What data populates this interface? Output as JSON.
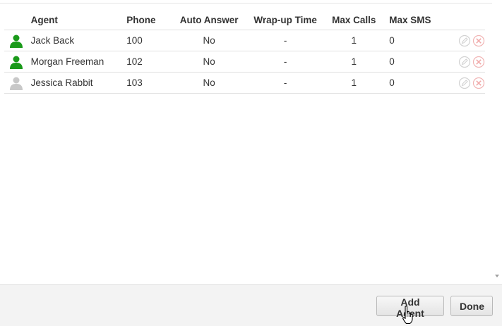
{
  "table": {
    "headers": {
      "agent": "Agent",
      "phone": "Phone",
      "auto_answer": "Auto Answer",
      "wrapup": "Wrap-up Time",
      "max_calls": "Max Calls",
      "max_sms": "Max SMS"
    },
    "rows": [
      {
        "status": "online",
        "name": "Jack Back",
        "phone": "100",
        "auto_answer": "No",
        "wrapup": "-",
        "max_calls": "1",
        "max_sms": "0"
      },
      {
        "status": "online",
        "name": "Morgan Freeman",
        "phone": "102",
        "auto_answer": "No",
        "wrapup": "-",
        "max_calls": "1",
        "max_sms": "0"
      },
      {
        "status": "offline",
        "name": "Jessica Rabbit",
        "phone": "103",
        "auto_answer": "No",
        "wrapup": "-",
        "max_calls": "1",
        "max_sms": "0"
      }
    ]
  },
  "footer": {
    "add_label": "Add Agent",
    "done_label": "Done"
  },
  "colors": {
    "online": "#1a9a1a",
    "offline": "#c8c8c8"
  },
  "icons": {
    "status": "user-icon",
    "edit": "edit-icon",
    "delete": "delete-icon"
  }
}
